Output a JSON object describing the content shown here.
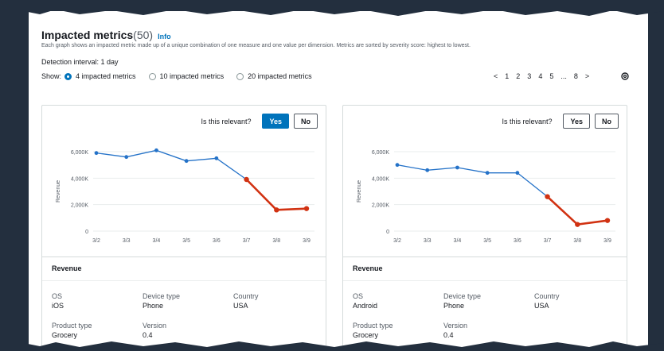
{
  "header": {
    "title": "Impacted metrics",
    "count": "(50)",
    "info": "Info",
    "description": "Each graph shows an impacted metric made up of a unique combination of one measure and one value per dimension. Metrics are sorted by severity score: highest to lowest.",
    "interval_label": "Detection interval: 1 day",
    "show_label": "Show:",
    "options": [
      "4 impacted metrics",
      "10 impacted metrics",
      "20 impacted metrics"
    ],
    "selected_option": 0
  },
  "pagination": {
    "prev": "<",
    "pages": [
      "1",
      "2",
      "3",
      "4",
      "5",
      "...",
      "8"
    ],
    "next": ">"
  },
  "relevance": {
    "question": "Is this relevant?",
    "yes": "Yes",
    "no": "No"
  },
  "colors": {
    "normal": "#2472c8",
    "anomaly": "#d13212",
    "primary": "#0073bb"
  },
  "cards": [
    {
      "measure": "Revenue",
      "selected": "yes",
      "attributes": [
        {
          "key": "OS",
          "value": "iOS"
        },
        {
          "key": "Device type",
          "value": "Phone"
        },
        {
          "key": "Country",
          "value": "USA"
        },
        {
          "key": "Product type",
          "value": "Grocery"
        },
        {
          "key": "Version",
          "value": "0.4"
        }
      ],
      "chart_data": {
        "type": "line",
        "ylabel": "Revenue",
        "ylim": [
          0,
          6000
        ],
        "yticks": [
          "0",
          "2,000K",
          "4,000K",
          "6,000K"
        ],
        "x": [
          "3/2",
          "3/3",
          "3/4",
          "3/5",
          "3/6",
          "3/7",
          "3/8",
          "3/9"
        ],
        "values": [
          5900,
          5600,
          6100,
          5300,
          5500,
          3900,
          1600,
          1700
        ],
        "anomaly_start_index": 5
      }
    },
    {
      "measure": "Revenue",
      "selected": "none",
      "attributes": [
        {
          "key": "OS",
          "value": "Android"
        },
        {
          "key": "Device type",
          "value": "Phone"
        },
        {
          "key": "Country",
          "value": "USA"
        },
        {
          "key": "Product type",
          "value": "Grocery"
        },
        {
          "key": "Version",
          "value": "0.4"
        }
      ],
      "chart_data": {
        "type": "line",
        "ylabel": "Revenue",
        "ylim": [
          0,
          6000
        ],
        "yticks": [
          "0",
          "2,000K",
          "4,000K",
          "6,000K"
        ],
        "x": [
          "3/2",
          "3/3",
          "3/4",
          "3/5",
          "3/6",
          "3/7",
          "3/8",
          "3/9"
        ],
        "values": [
          5000,
          4600,
          4800,
          4400,
          4400,
          2600,
          500,
          800
        ],
        "anomaly_start_index": 5
      }
    }
  ]
}
